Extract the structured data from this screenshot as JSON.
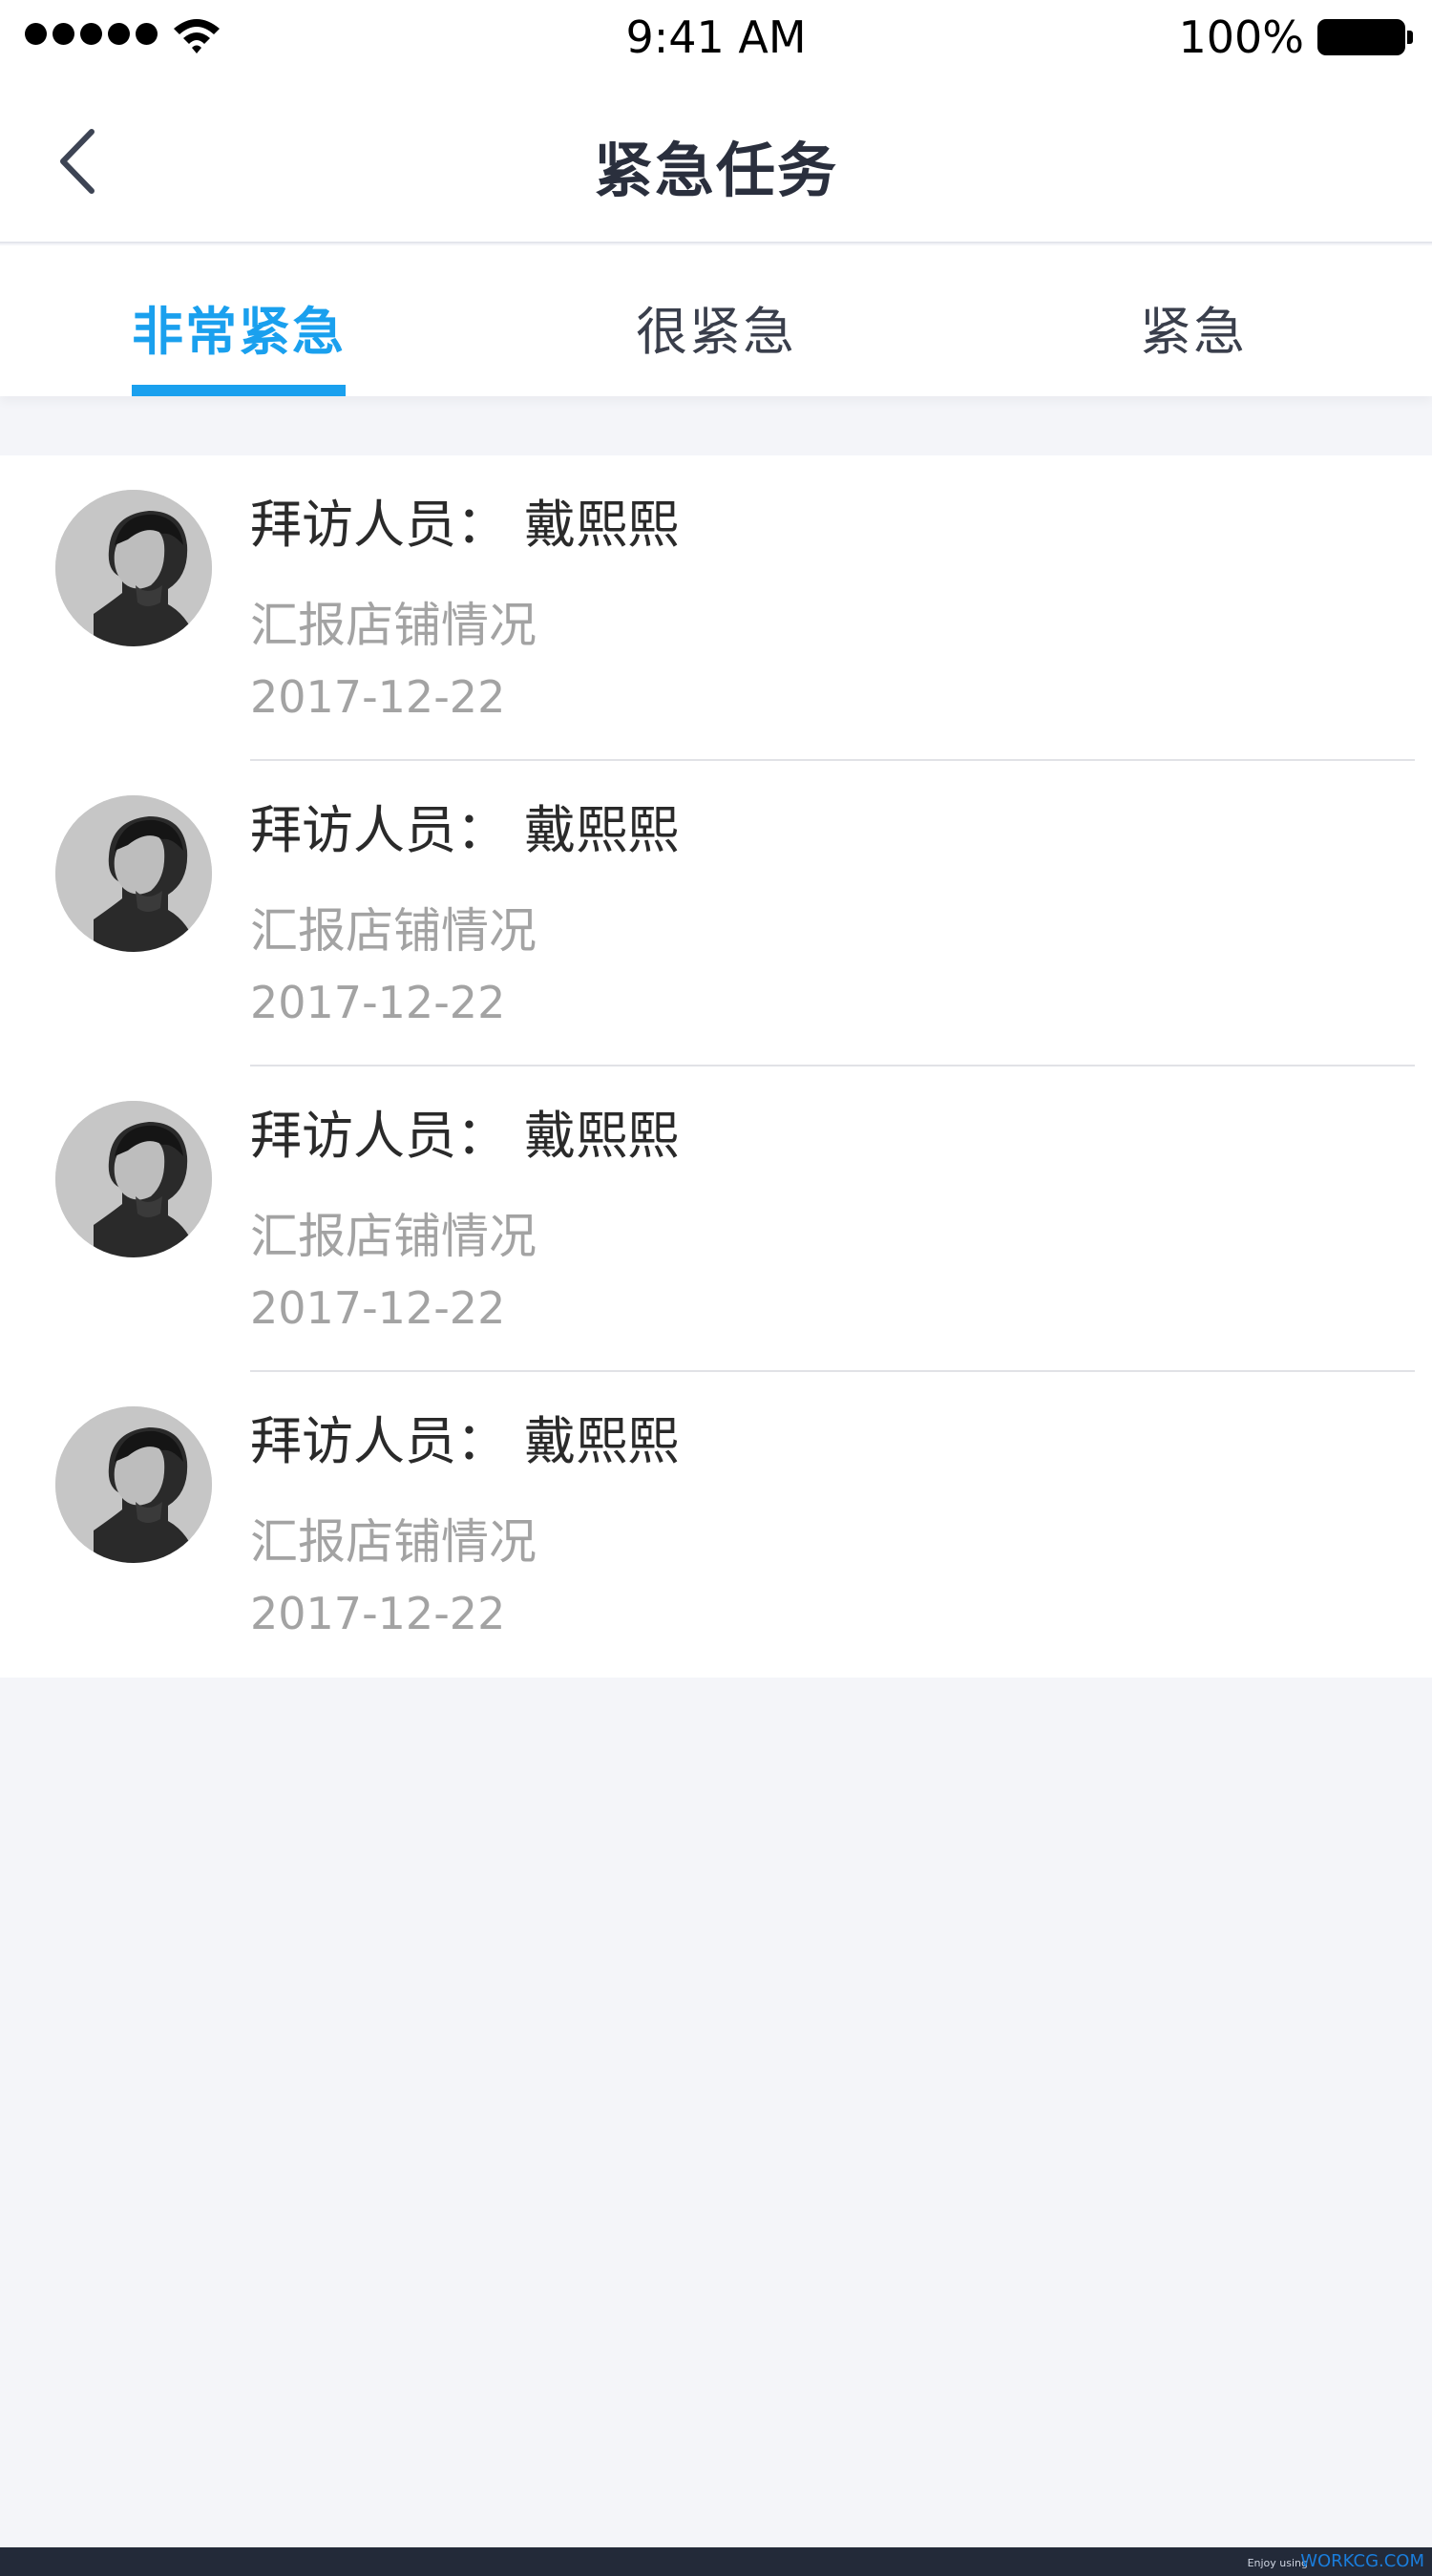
{
  "status_bar": {
    "time": "9:41 AM",
    "battery": "100%",
    "signal_icon": "signal-dots-icon",
    "wifi_icon": "wifi-icon",
    "battery_icon": "battery-icon"
  },
  "nav": {
    "title": "紧急任务",
    "back_icon": "chevron-left-icon"
  },
  "tabs": [
    {
      "label": "非常紧急",
      "active": true
    },
    {
      "label": "很紧急",
      "active": false
    },
    {
      "label": "紧急",
      "active": false
    }
  ],
  "colors": {
    "accent": "#1aa0ee",
    "background": "#f4f5f9",
    "title_text": "#2a2f3d",
    "secondary_text": "#a3a3a3"
  },
  "tasks": [
    {
      "title": "拜访人员：  戴熙熙",
      "description": "汇报店铺情况",
      "date": "2017-12-22",
      "avatar_icon": "person-avatar"
    },
    {
      "title": "拜访人员：  戴熙熙",
      "description": "汇报店铺情况",
      "date": "2017-12-22",
      "avatar_icon": "person-avatar"
    },
    {
      "title": "拜访人员：  戴熙熙",
      "description": "汇报店铺情况",
      "date": "2017-12-22",
      "avatar_icon": "person-avatar"
    },
    {
      "title": "拜访人员：  戴熙熙",
      "description": "汇报店铺情况",
      "date": "2017-12-22",
      "avatar_icon": "person-avatar"
    }
  ],
  "footer": {
    "enjoy": "Enjoy using",
    "watermark": "WORKCG.COM"
  }
}
